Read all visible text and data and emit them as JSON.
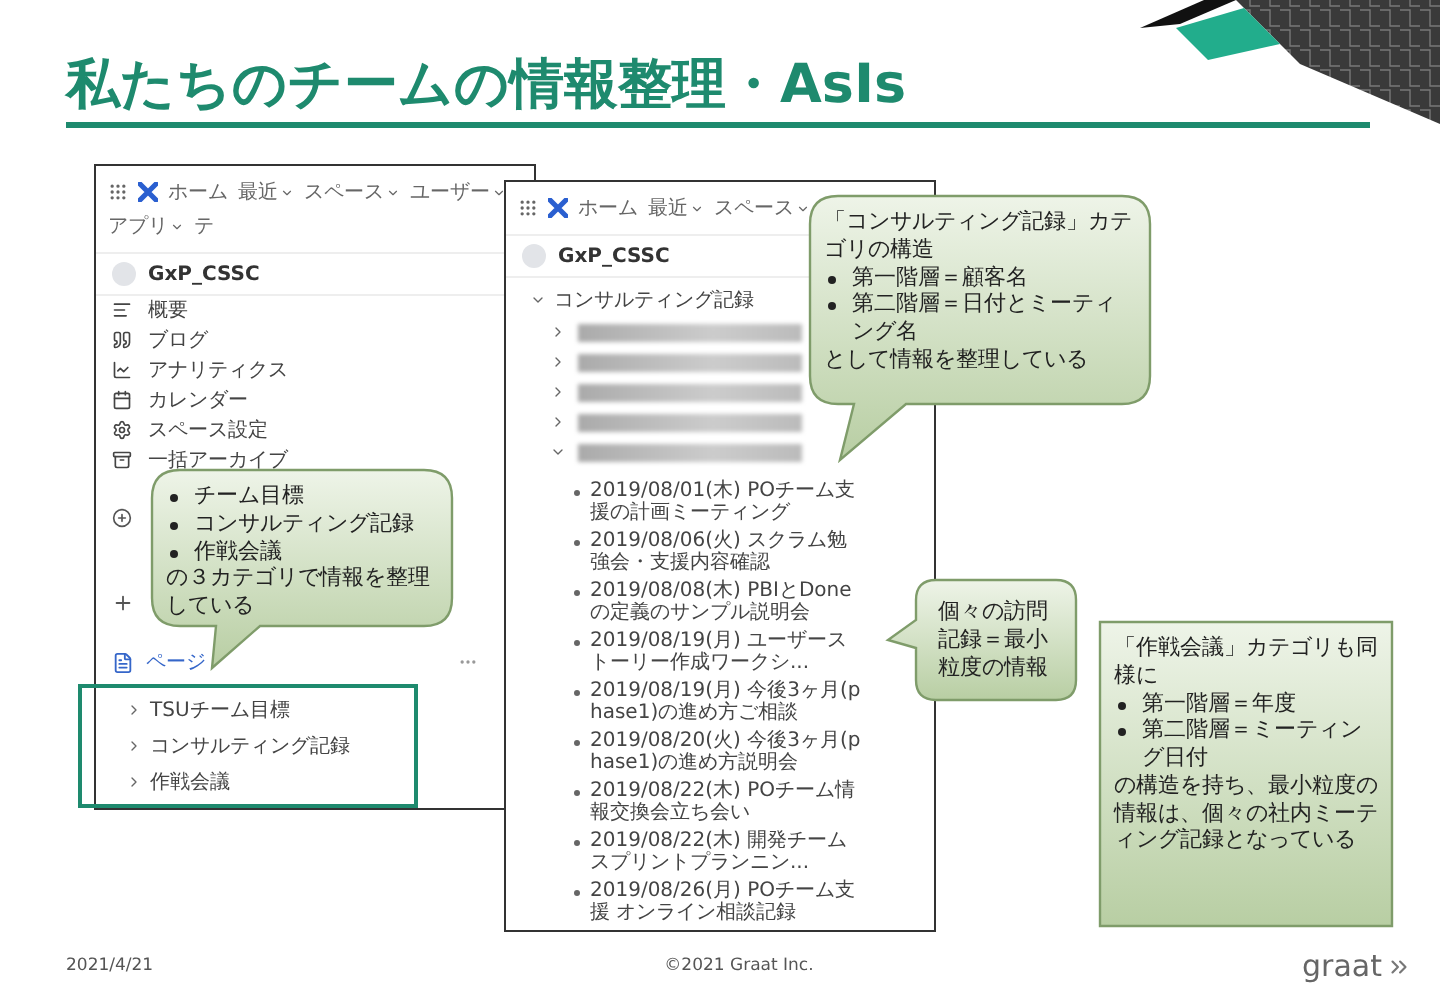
{
  "title": "私たちのチームの情報整理・AsIs",
  "left_screenshot": {
    "nav_items": [
      {
        "label": "ホーム",
        "dropdown": false
      },
      {
        "label": "最近",
        "dropdown": true
      },
      {
        "label": "スペース",
        "dropdown": true
      },
      {
        "label": "ユーザー",
        "dropdown": true
      },
      {
        "label": "アプリ",
        "dropdown": true
      },
      {
        "label": "テ",
        "dropdown": false
      }
    ],
    "space_name": "GxP_CSSC",
    "sidebar_items": [
      "概要",
      "ブログ",
      "アナリティクス",
      "カレンダー",
      "スペース設定",
      "一括アーカイブ"
    ],
    "pages_label": "ページ",
    "page_tree": [
      {
        "label": "TSUチーム目標",
        "expanded": false
      },
      {
        "label": "コンサルティング記録",
        "expanded": false
      },
      {
        "label": "作戦会議",
        "expanded": false
      }
    ]
  },
  "right_screenshot": {
    "nav_items": [
      {
        "label": "ホーム",
        "dropdown": false
      },
      {
        "label": "最近",
        "dropdown": true
      },
      {
        "label": "スペース",
        "dropdown": true
      }
    ],
    "space_name": "GxP_CSSC",
    "tree": {
      "label": "コンサルティング記録",
      "expanded": true,
      "children": [
        {
          "expanded": false
        },
        {
          "expanded": false
        },
        {
          "expanded": false
        },
        {
          "expanded": false
        },
        {
          "expanded": true,
          "children": [
            {
              "label": "2019/08/01(木) POチーム支援の計画ミーティング"
            },
            {
              "label": "2019/08/06(火) スクラム勉強会・支援内容確認"
            },
            {
              "label": "2019/08/08(木) PBIとDoneの定義のサンプル説明会"
            },
            {
              "label": "2019/08/19(月) ユーザーストーリー作成ワークシ..."
            },
            {
              "label": "2019/08/19(月) 今後3ヶ月(phase1)の進め方ご相談"
            },
            {
              "label": "2019/08/20(火) 今後3ヶ月(phase1)の進め方説明会"
            },
            {
              "label": "2019/08/22(木) POチーム情報交換会立ち会い"
            },
            {
              "label": "2019/08/22(木) 開発チームスプリントプランニン..."
            },
            {
              "label": "2019/08/26(月) POチーム支援 オンライン相談記録"
            }
          ]
        }
      ]
    }
  },
  "callouts": [
    {
      "lines": [
        {
          "kind": "bullet",
          "text": "チーム目標"
        },
        {
          "kind": "bullet",
          "text": "コンサルティング記録"
        },
        {
          "kind": "bullet",
          "text": "作戦会議"
        },
        {
          "kind": "text",
          "text": "の３カテゴリで情報を整理している"
        }
      ]
    },
    {
      "lines": [
        {
          "kind": "text",
          "text": "「コンサルティング記録」カテゴリの構造"
        },
        {
          "kind": "bullet",
          "text": "第一階層＝顧客名"
        },
        {
          "kind": "bullet",
          "text": "第二階層＝日付とミーティング名"
        },
        {
          "kind": "text",
          "text": "として情報を整理している"
        }
      ]
    },
    {
      "lines": [
        {
          "kind": "text",
          "text": "個々の訪問記録＝最小粒度の情報"
        }
      ]
    },
    {
      "lines": [
        {
          "kind": "text",
          "text": "「作戦会議」カテゴリも同様に"
        },
        {
          "kind": "bullet",
          "text": "第一階層＝年度"
        },
        {
          "kind": "bullet",
          "text": "第二階層＝ミーティング日付"
        },
        {
          "kind": "text",
          "text": "の構造を持ち、最小粒度の情報は、個々の社内ミーティング記録となっている"
        }
      ]
    }
  ],
  "footer": {
    "date": "2021/4/21",
    "copyright": "©2021 Graat Inc.",
    "logo": "graat"
  }
}
